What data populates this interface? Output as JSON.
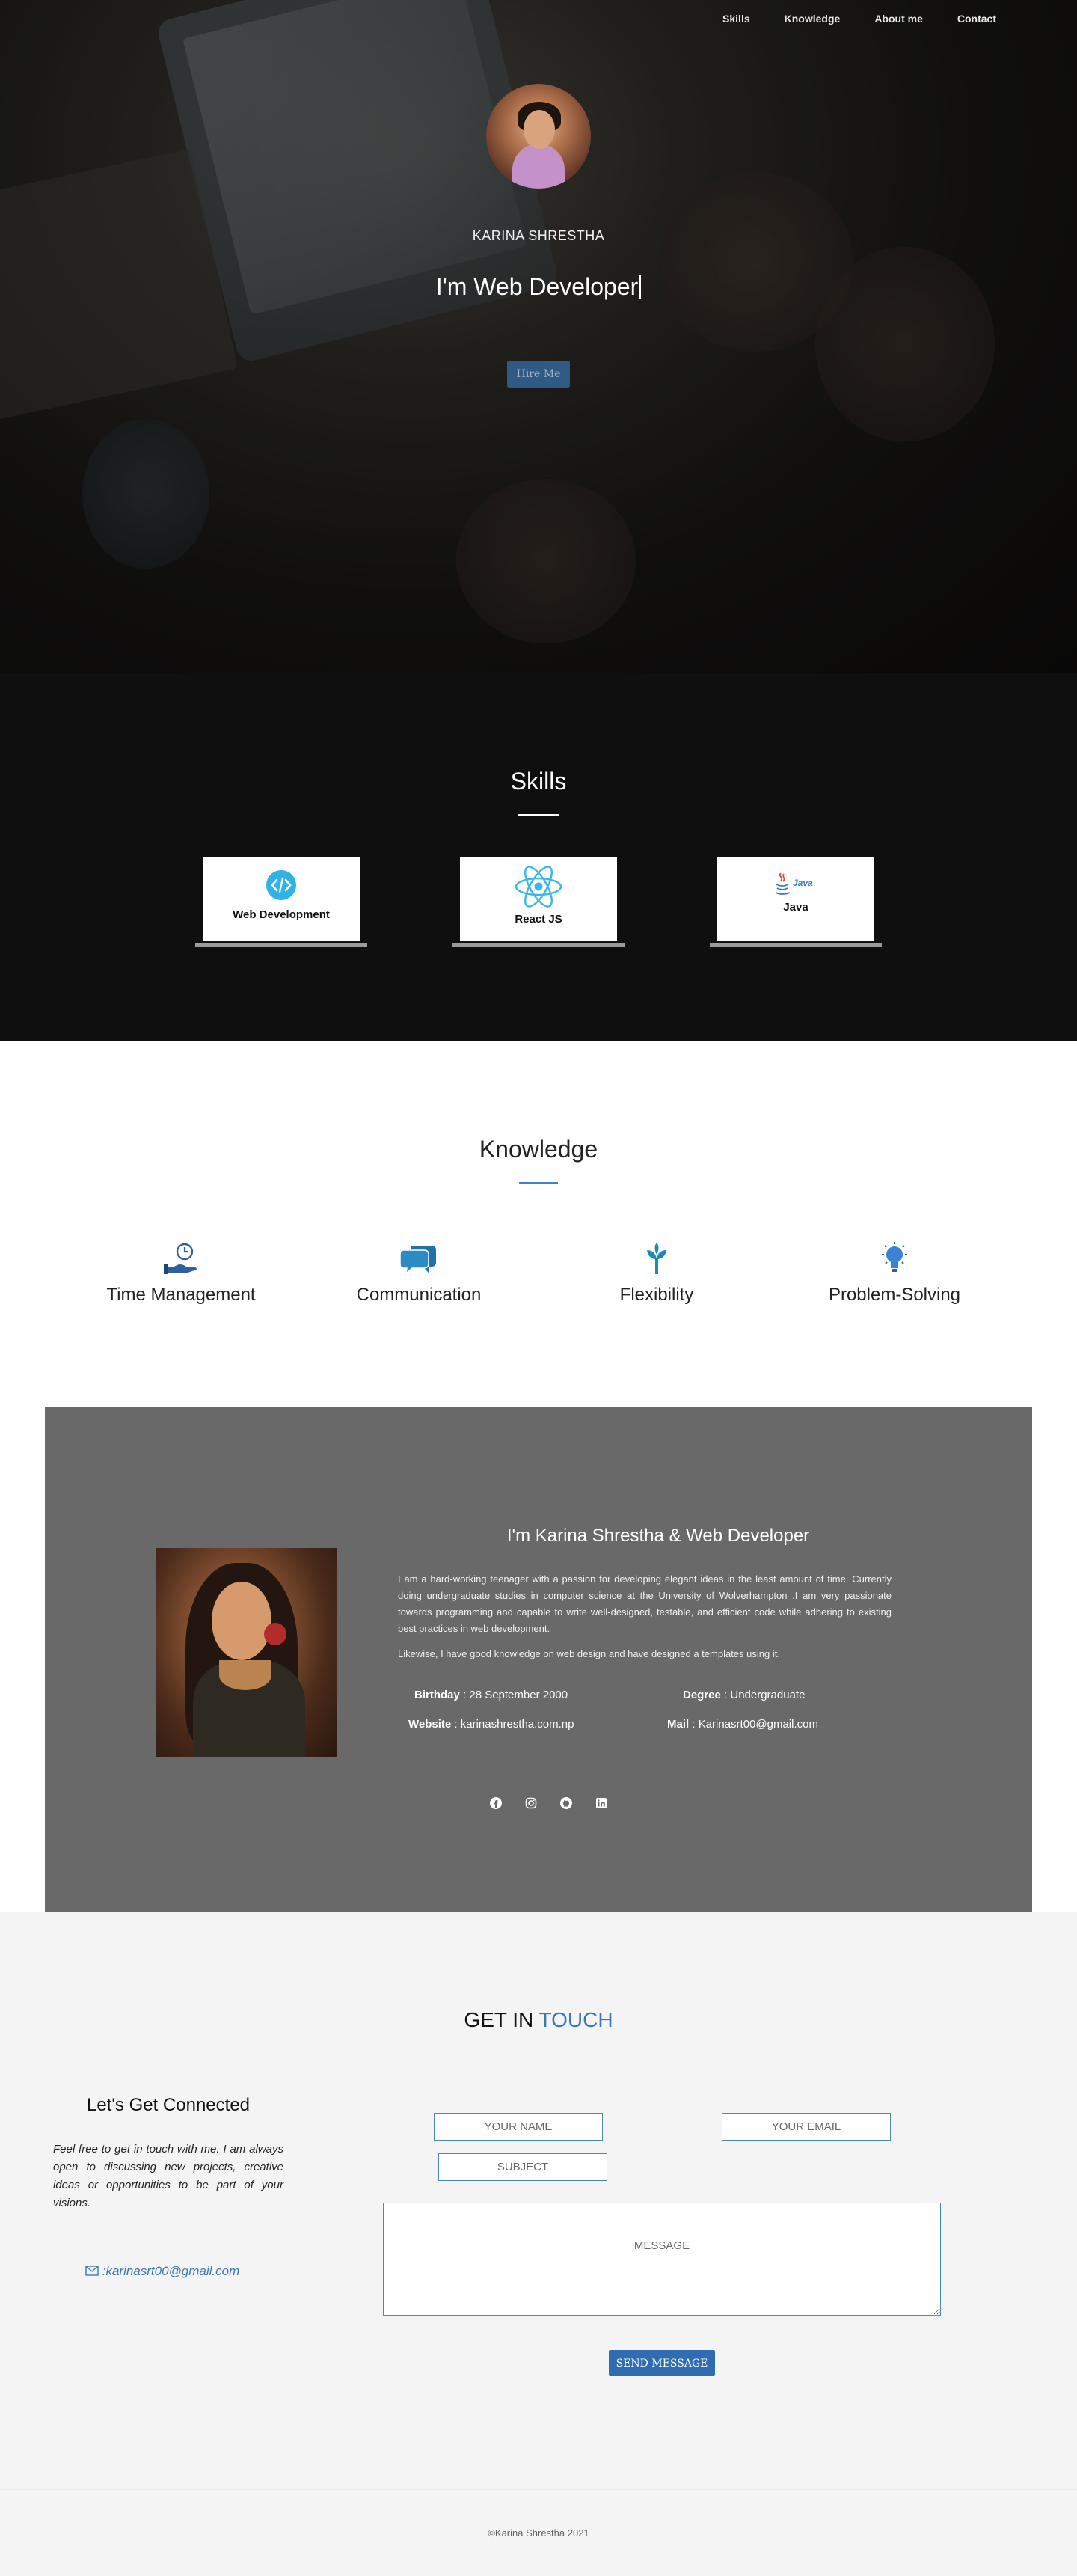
{
  "nav": {
    "items": [
      {
        "label": "Skills"
      },
      {
        "label": "Knowledge"
      },
      {
        "label": "About me"
      },
      {
        "label": "Contact"
      }
    ]
  },
  "hero": {
    "name": "KARINA SHRESTHA",
    "role": "I'm Web Developer",
    "hire_label": "Hire Me"
  },
  "skills": {
    "title": "Skills",
    "cards": [
      {
        "label": "Web Development",
        "icon": "code-icon",
        "color": "#2fb2e6"
      },
      {
        "label": "React JS",
        "icon": "react-icon",
        "color": "#3ab7e9"
      },
      {
        "label": "Java",
        "icon": "java-icon",
        "color": "#3a7fc1"
      }
    ]
  },
  "knowledge": {
    "title": "Knowledge",
    "accent": "#3b82d4",
    "items": [
      {
        "label": "Time Management",
        "icon": "time-management-icon"
      },
      {
        "label": "Communication",
        "icon": "chat-bubbles-icon"
      },
      {
        "label": "Flexibility",
        "icon": "sprout-icon"
      },
      {
        "label": "Problem-Solving",
        "icon": "lightbulb-icon"
      }
    ]
  },
  "about": {
    "heading": "I'm Karina Shrestha & Web Developer",
    "bio_1": "I am a hard-working teenager with a passion for developing elegant ideas in the least amount of time. Currently doing undergraduate studies in computer science at the University of Wolverhampton .I am very passionate towards programming and capable to write well-designed, testable, and efficient code while adhering to existing best practices in web development.",
    "bio_2": "Likewise, I have good knowledge on web design and have designed a templates using it.",
    "birthday_label": "Birthday",
    "birthday_value": " : 28 September 2000",
    "degree_label": "Degree",
    "degree_value": " : Undergraduate",
    "website_label": "Website",
    "website_value": " : karinashrestha.com.np",
    "mail_label": "Mail",
    "mail_value": " : Karinasrt00@gmail.com",
    "social": [
      "facebook-icon",
      "instagram-icon",
      "github-icon",
      "linkedin-icon"
    ]
  },
  "contact": {
    "title_part1": "GET IN ",
    "title_part2": "TOUCH",
    "accent": "#3a78b5",
    "left_heading": "Let's Get Connected",
    "left_text": "Feel free to get in touch with me. I am always open to discussing new projects, creative ideas or opportunities to be part of your visions.",
    "email": ":karinasrt00@gmail.com",
    "name_placeholder": "YOUR NAME",
    "email_placeholder": "YOUR EMAIL",
    "subject_placeholder": "SUBJECT",
    "message_placeholder": "MESSAGE",
    "send_label": "SEND MESSAGE"
  },
  "footer": {
    "copyright": "©Karina Shrestha 2021"
  }
}
